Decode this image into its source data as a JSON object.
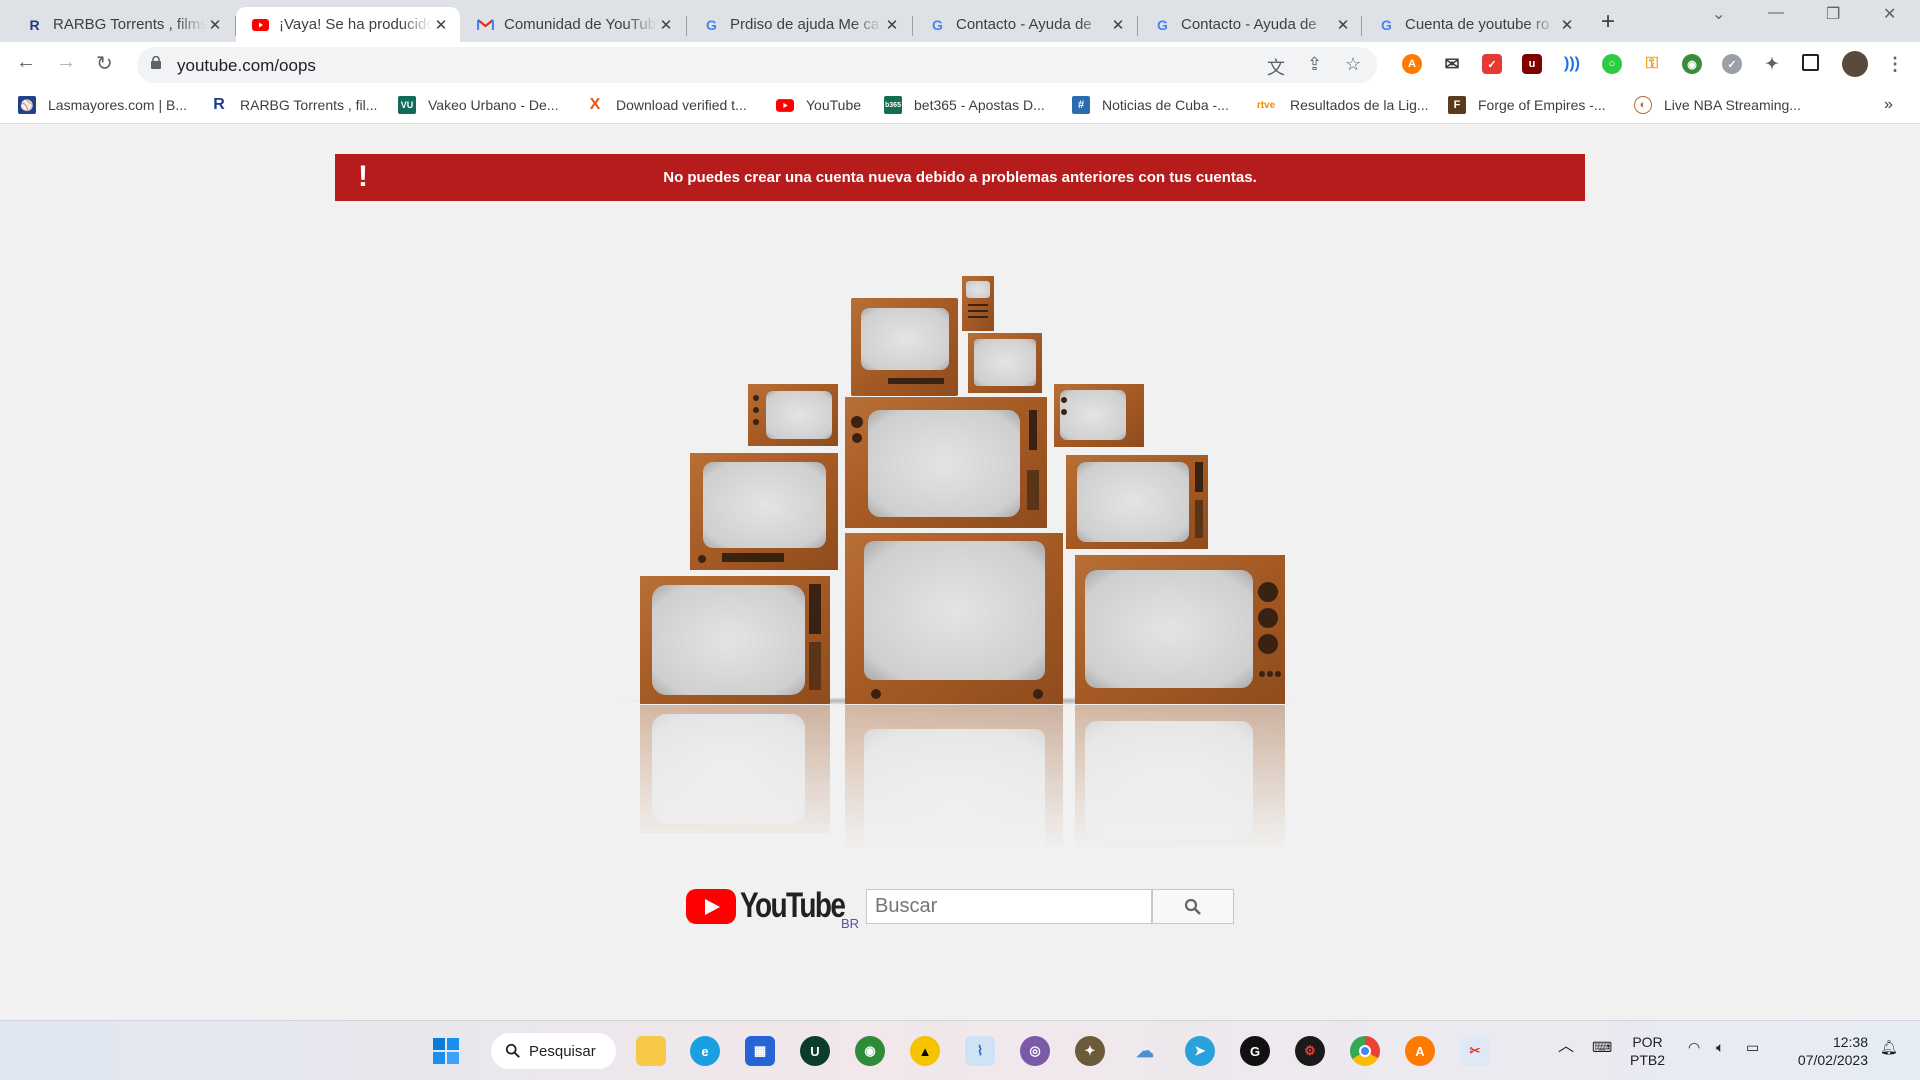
{
  "browser": {
    "tabs": [
      {
        "title": "RARBG Torrents , films",
        "favicon": "R",
        "color": "#1f3a8a"
      },
      {
        "title": "¡Vaya! Se ha producido",
        "favicon": "youtube-icon",
        "color": "#ff0000",
        "active": true
      },
      {
        "title": "Comunidad de YouTube",
        "favicon": "gmail-icon",
        "color": "#d93025"
      },
      {
        "title": "Prdiso de ajuda Me ca",
        "favicon": "G",
        "color": "#4285f4"
      },
      {
        "title": "Contacto - Ayuda de",
        "favicon": "G",
        "color": "#4285f4"
      },
      {
        "title": "Contacto - Ayuda de",
        "favicon": "G",
        "color": "#4285f4"
      },
      {
        "title": "Cuenta de youtube ro",
        "favicon": "G",
        "color": "#4285f4"
      }
    ],
    "url": "youtube.com/oops",
    "bookmarks": [
      {
        "label": "Lasmayores.com | B...",
        "icon": "mlb-icon",
        "color": "#1d428a"
      },
      {
        "label": "RARBG Torrents , fil...",
        "icon": "R",
        "color": "#1f3a8a"
      },
      {
        "label": "Vakeo Urbano - De...",
        "icon": "VU",
        "color": "#0f6b5c"
      },
      {
        "label": "Download verified t...",
        "icon": "X",
        "color": "#e8551c"
      },
      {
        "label": "YouTube",
        "icon": "youtube-icon",
        "color": "#ff0000"
      },
      {
        "label": "bet365 - Apostas D...",
        "icon": "bet365",
        "color": "#126e51"
      },
      {
        "label": "Noticias de Cuba -...",
        "icon": "#",
        "color": "#2b6cb0"
      },
      {
        "label": "Resultados de la Lig...",
        "icon": "rtve",
        "color": "#f28c00"
      },
      {
        "label": "Forge of Empires -...",
        "icon": "F",
        "color": "#5a3a1a"
      },
      {
        "label": "Live NBA Streaming...",
        "icon": "basketball-icon",
        "color": "#b07040"
      }
    ]
  },
  "page": {
    "alert_text": "No puedes crear una cuenta nueva debido a problemas anteriores con tus cuentas.",
    "alert_icon": "!",
    "logo_text": "YouTube",
    "country_code": "BR",
    "search_placeholder": "Buscar"
  },
  "taskbar": {
    "search_label": "Pesquisar",
    "lang_line1": "POR",
    "lang_line2": "PTB2",
    "time": "12:38",
    "date": "07/02/2023"
  }
}
